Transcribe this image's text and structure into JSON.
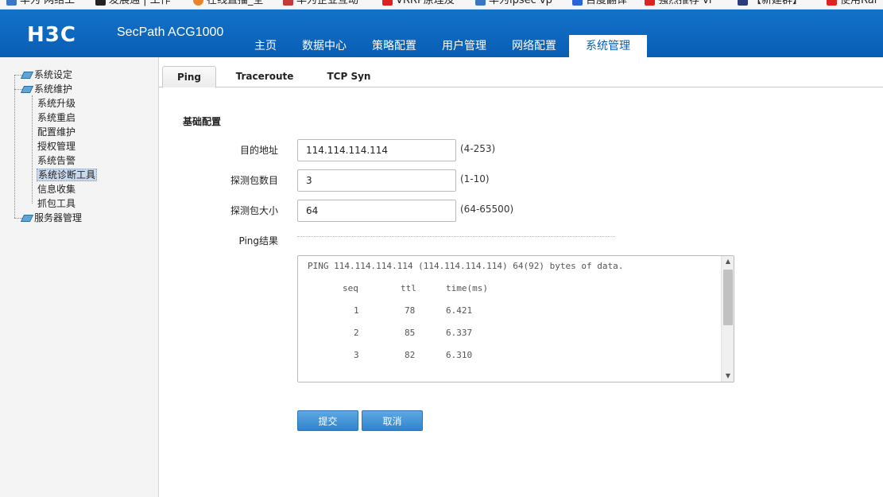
{
  "bookmarks": [
    "华为 网络工",
    "发展通 | 工作",
    "在线直播_全",
    "华为企业互动",
    "VRRP原理及",
    "华为ipsec vp",
    "百度翻译",
    "强烈推荐 vi",
    "【新建群】",
    "使用Rar"
  ],
  "header": {
    "logo": "H3C",
    "product": "SecPath ACG1000",
    "nav": [
      "主页",
      "数据中心",
      "策略配置",
      "用户管理",
      "网络配置",
      "系统管理"
    ],
    "active_nav": "系统管理"
  },
  "sidebar": {
    "tree": [
      {
        "label": "系统设定",
        "level": 0
      },
      {
        "label": "系统维护",
        "level": 0
      },
      {
        "label": "系统升级",
        "level": 1
      },
      {
        "label": "系统重启",
        "level": 1
      },
      {
        "label": "配置维护",
        "level": 1
      },
      {
        "label": "授权管理",
        "level": 1
      },
      {
        "label": "系统告警",
        "level": 1
      },
      {
        "label": "系统诊断工具",
        "level": 1,
        "selected": true
      },
      {
        "label": "信息收集",
        "level": 1
      },
      {
        "label": "抓包工具",
        "level": 1
      },
      {
        "label": "服务器管理",
        "level": 0
      }
    ]
  },
  "tabs": [
    "Ping",
    "Traceroute",
    "TCP Syn"
  ],
  "active_tab": "Ping",
  "form": {
    "section_title": "基础配置",
    "dest_label": "目的地址",
    "dest_value": "114.114.114.114",
    "dest_hint": "(4-253)",
    "count_label": "探测包数目",
    "count_value": "3",
    "count_hint": "(1-10)",
    "size_label": "探测包大小",
    "size_value": "64",
    "size_hint": "(64-65500)",
    "result_label": "Ping结果"
  },
  "ping_result": {
    "header_line": "PING 114.114.114.114 (114.114.114.114) 64(92) bytes of data.",
    "columns": [
      "seq",
      "ttl",
      "time(ms)"
    ],
    "rows": [
      {
        "seq": "1",
        "ttl": "78",
        "time": "6.421"
      },
      {
        "seq": "2",
        "ttl": "85",
        "time": "6.337"
      },
      {
        "seq": "3",
        "ttl": "82",
        "time": "6.310"
      }
    ]
  },
  "buttons": {
    "submit": "提交",
    "cancel": "取消"
  }
}
